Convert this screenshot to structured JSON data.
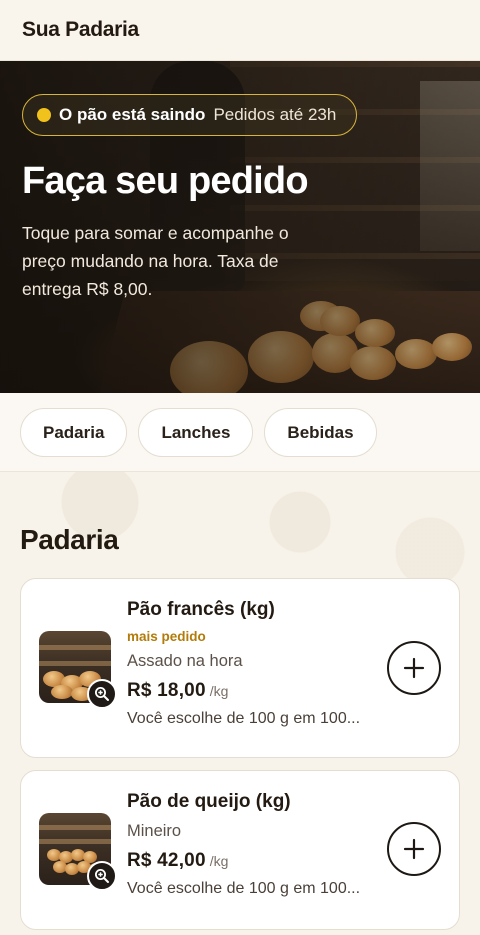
{
  "header": {
    "brand": "Sua Padaria"
  },
  "hero": {
    "status_strong": "O pão está saindo",
    "status_light": "Pedidos até 23h",
    "title": "Faça seu pedido",
    "text": "Toque para somar e acompanhe o preço mudando na hora. Taxa de entrega R$ 8,00."
  },
  "tabs": [
    {
      "label": "Padaria"
    },
    {
      "label": "Lanches"
    },
    {
      "label": "Bebidas"
    }
  ],
  "section": {
    "title": "Padaria",
    "products": [
      {
        "name": "Pão francês (kg)",
        "badge": "mais pedido",
        "desc": "Assado na hora",
        "price": "R$ 18,00",
        "unit": "/kg",
        "note": "Você escolhe de 100 g em 100..."
      },
      {
        "name": "Pão de queijo (kg)",
        "desc": "Mineiro",
        "price": "R$ 42,00",
        "unit": "/kg",
        "note": "Você escolhe de 100 g em 100..."
      }
    ]
  },
  "icons": {
    "zoom": "zoom-in-icon",
    "add": "plus-icon"
  },
  "colors": {
    "accent": "#d8b53a",
    "status_dot": "#f1c21b",
    "badge": "#b27b0a"
  }
}
